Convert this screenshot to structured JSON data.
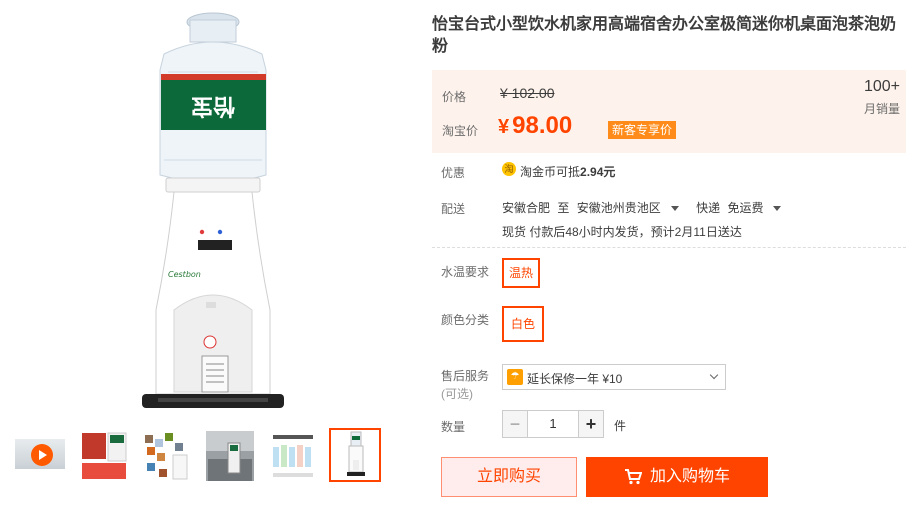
{
  "product": {
    "title": "怡宝台式小型饮水机家用高端宿舍办公室极简迷你机桌面泡茶泡奶粉",
    "bottle_label": "怡宝",
    "machine_brand": "Cestbon"
  },
  "price": {
    "orig_label": "价格",
    "orig_value": "¥ 102.00",
    "taobao_label": "淘宝价",
    "currency": "¥",
    "current_value": "98.00",
    "newbie_tag": "新客专享价",
    "sales_count": "100+",
    "sales_label": "月销量"
  },
  "discount": {
    "label": "优惠",
    "coin_icon_char": "淘",
    "text_prefix": "淘金币可抵",
    "text_amount": "2.94元"
  },
  "shipping": {
    "label": "配送",
    "from": "安徽合肥",
    "to_word": "至",
    "to": "安徽池州贵池区",
    "method": "快递",
    "fee": "免运费",
    "note": "现货 付款后48小时内发货，预计2月11日送达"
  },
  "options": {
    "water_temp_label": "水温要求",
    "water_temp_value": "温热",
    "color_label": "颜色分类",
    "color_value": "白色",
    "after_sale_label": "售后服务",
    "after_sale_sub": "(可选)",
    "after_sale_value": "延长保修一年 ¥10"
  },
  "quantity": {
    "label": "数量",
    "minus": "−",
    "value": "1",
    "plus": "+",
    "unit": "件"
  },
  "actions": {
    "buy_now": "立即购买",
    "add_cart": "加入购物车"
  },
  "colors": {
    "accent": "#ff4400",
    "price_bg": "#fef3ec",
    "tag_orange": "#ff8c1a"
  }
}
